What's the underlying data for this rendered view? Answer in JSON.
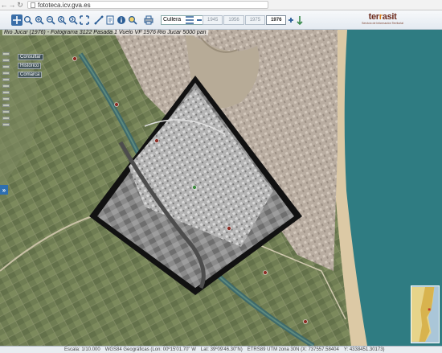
{
  "browser": {
    "back_icon": "back-arrow-icon",
    "forward_icon": "forward-arrow-icon",
    "reload_icon": "reload-icon",
    "url": "fototeca.icv.gva.es"
  },
  "toolbar": {
    "tool_icons": [
      "pan-icon",
      "zoom-box-icon",
      "zoom-in-icon",
      "zoom-out-icon",
      "zoom-previous-icon",
      "zoom-next-icon",
      "full-extent-icon",
      "measure-icon",
      "document-icon",
      "info-icon",
      "find-icon",
      "print-icon"
    ],
    "search_value": "Cullera",
    "years": [
      "1945",
      "1956",
      "1975",
      "1976"
    ],
    "active_year": "1976"
  },
  "logo": {
    "word_left": "ter",
    "word_dot": "r",
    "word_right": "asit",
    "tagline": "Servicio de Información Territorial"
  },
  "map": {
    "caption": "Rio Jucar (1976) - Fotograma 3122 Pasada 1 Vuelo VF 1976 Rio Jucar 5000 pan",
    "layers": [
      "Consultar",
      "Histórico",
      "Comarca"
    ],
    "expander_label": "»",
    "colors": {
      "sea": "#2f7c82",
      "beach": "#d9c6a2",
      "urban": "#b8aca0",
      "fields": "#6f7d53"
    }
  },
  "status": {
    "scale": "Escala: 1/10.000",
    "crs": "WGS84 Geográficas (Lon: 00º15'01.70\" W",
    "lat": "Lat: 39º09'46.30\"N)",
    "utm": "ETRS89 UTM zona 30N (X: 737557.58404",
    "y": "Y: 4338451.30173)"
  }
}
